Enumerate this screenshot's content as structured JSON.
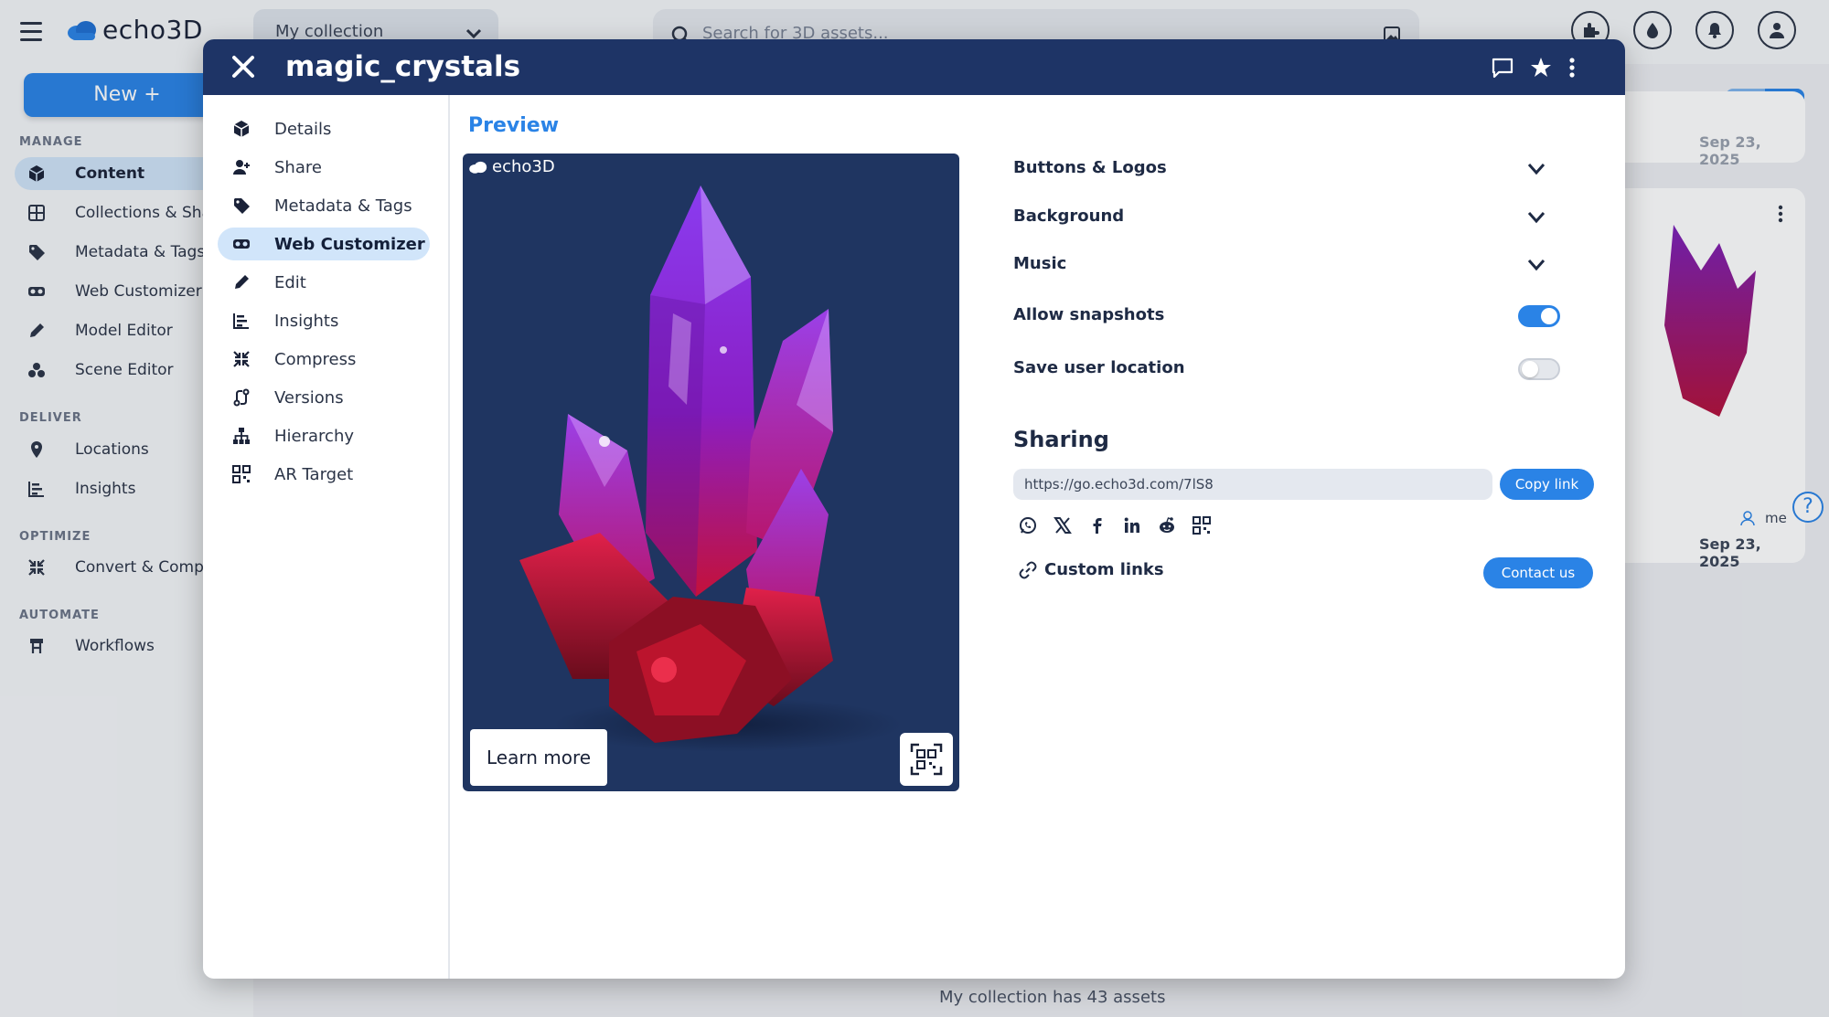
{
  "app": {
    "logo_text": "echo3D",
    "collection_select": "My collection",
    "search_placeholder": "Search for 3D assets...",
    "new_button": "New +"
  },
  "sidebar": {
    "sections": [
      {
        "title": "MANAGE",
        "items": [
          {
            "label": "Content",
            "icon": "cube-icon",
            "active": true
          },
          {
            "label": "Collections & Sharin",
            "icon": "grid-icon"
          },
          {
            "label": "Metadata & Tags",
            "icon": "tag-icon"
          },
          {
            "label": "Web Customizer",
            "icon": "vr-goggles-icon"
          },
          {
            "label": "Model Editor",
            "icon": "pencil-icon"
          },
          {
            "label": "Scene Editor",
            "icon": "shapes-icon"
          }
        ]
      },
      {
        "title": "DELIVER",
        "items": [
          {
            "label": "Locations",
            "icon": "location-pin-icon"
          },
          {
            "label": "Insights",
            "icon": "bar-chart-icon"
          }
        ]
      },
      {
        "title": "OPTIMIZE",
        "items": [
          {
            "label": "Convert & Compres",
            "icon": "compress-icon"
          }
        ]
      },
      {
        "title": "AUTOMATE",
        "items": [
          {
            "label": "Workflows",
            "icon": "workflow-icon"
          }
        ]
      }
    ]
  },
  "background_content": {
    "card_date_top": "Sep 23, 2025",
    "card_date": "Sep 23, 2025",
    "card_user": "me",
    "footer_text": "My collection has 43 assets"
  },
  "modal": {
    "title": "magic_crystals",
    "nav": [
      {
        "label": "Details",
        "icon": "cube-icon"
      },
      {
        "label": "Share",
        "icon": "add-user-icon"
      },
      {
        "label": "Metadata & Tags",
        "icon": "tag-icon"
      },
      {
        "label": "Web Customizer",
        "icon": "vr-goggles-icon",
        "active": true
      },
      {
        "label": "Edit",
        "icon": "pencil-icon"
      },
      {
        "label": "Insights",
        "icon": "bar-chart-icon"
      },
      {
        "label": "Compress",
        "icon": "compress-icon"
      },
      {
        "label": "Versions",
        "icon": "versions-icon"
      },
      {
        "label": "Hierarchy",
        "icon": "hierarchy-icon"
      },
      {
        "label": "AR Target",
        "icon": "qr-code-icon"
      }
    ],
    "preview": {
      "title": "Preview",
      "logo_text": "echo3D",
      "learn_more": "Learn more"
    },
    "settings": {
      "buttons_logos": "Buttons & Logos",
      "background": "Background",
      "music": "Music",
      "allow_snapshots": "Allow snapshots",
      "allow_snapshots_on": true,
      "save_user_location": "Save user location",
      "save_user_location_on": false
    },
    "sharing": {
      "title": "Sharing",
      "url": "https://go.echo3d.com/7lS8",
      "copy_link": "Copy link",
      "icons": [
        "whatsapp-icon",
        "x-icon",
        "facebook-icon",
        "linkedin-icon",
        "reddit-icon",
        "qr-code-icon"
      ],
      "custom_links": "Custom links",
      "contact_us": "Contact us"
    }
  },
  "colors": {
    "accent": "#2a83e6",
    "header": "#1e3466",
    "preview_bg": "#1f3561"
  }
}
